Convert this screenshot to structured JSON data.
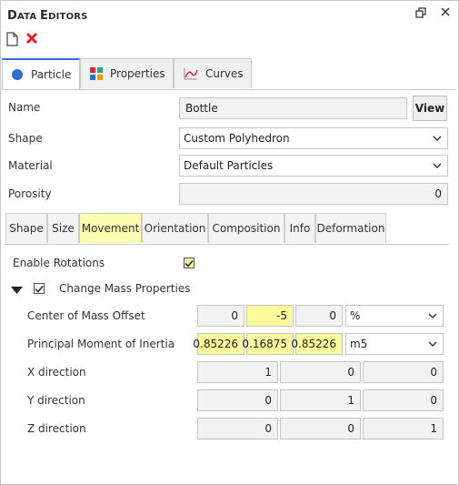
{
  "window": {
    "title_big_d": "D",
    "title_sm1": "ATA ",
    "title_big_e": "E",
    "title_sm2": "DITORS"
  },
  "main_tabs": [
    {
      "label": "Particle",
      "active": true
    },
    {
      "label": "Properties",
      "active": false
    },
    {
      "label": "Curves",
      "active": false
    }
  ],
  "fields": {
    "name_label": "Name",
    "name_value": "Bottle",
    "view_button": "View",
    "shape_label": "Shape",
    "shape_value": "Custom Polyhedron",
    "material_label": "Material",
    "material_value": "Default Particles",
    "porosity_label": "Porosity",
    "porosity_value": "0"
  },
  "sub_tabs": [
    {
      "label": "Shape"
    },
    {
      "label": "Size"
    },
    {
      "label": "Movement",
      "active": true
    },
    {
      "label": "Orientation"
    },
    {
      "label": "Composition"
    },
    {
      "label": "Info"
    },
    {
      "label": "Deformation"
    }
  ],
  "movement": {
    "enable_rotations_label": "Enable Rotations",
    "enable_rotations_checked": true,
    "change_mass_label": "Change Mass Properties",
    "change_mass_checked": true,
    "com_label": "Center of Mass Offset",
    "com_values": [
      "0",
      "-5",
      "0"
    ],
    "com_unit": "%",
    "pmi_label": "Principal Moment of Inertia",
    "pmi_values": [
      "0.85226",
      "0.16875",
      "0.85226"
    ],
    "pmi_unit": "m5",
    "x_label": "X direction",
    "x_values": [
      "1",
      "0",
      "0"
    ],
    "y_label": "Y direction",
    "y_values": [
      "0",
      "1",
      "0"
    ],
    "z_label": "Z direction",
    "z_values": [
      "0",
      "0",
      "1"
    ]
  },
  "colors": {
    "accent": "#2f6fd6",
    "highlight": "#fbfb9e",
    "delete_red": "#e02020"
  }
}
